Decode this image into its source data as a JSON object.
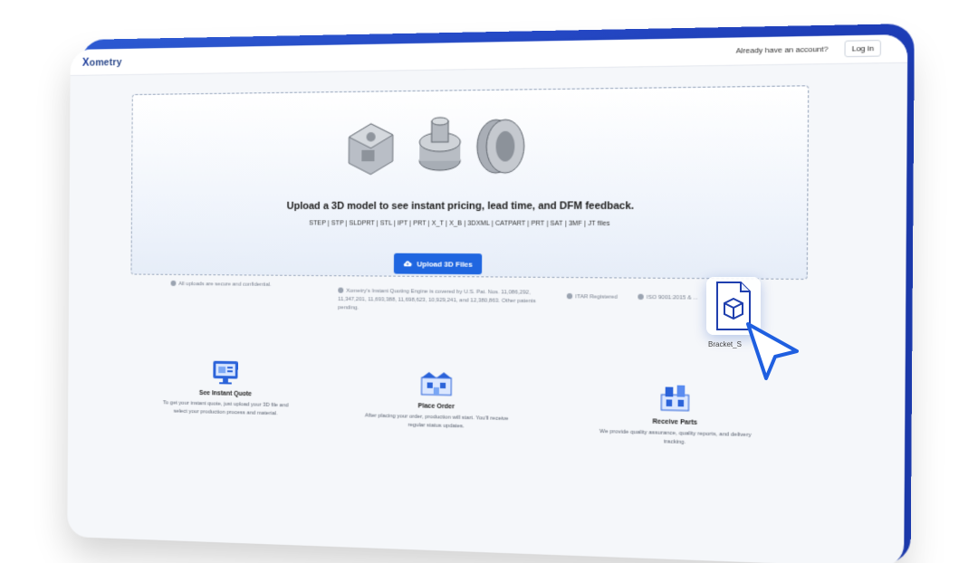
{
  "header": {
    "logo_mark": "X",
    "logo_text": "ometry",
    "account_prompt": "Already have an account?",
    "login_label": "Log in"
  },
  "upload": {
    "headline": "Upload a 3D model to see instant pricing, lead time, and DFM feedback.",
    "formats": "STEP | STP | SLDPRT | STL | IPT | PRT | X_T | X_B | 3DXML | CATPART | PRT | SAT | 3MF | JT files",
    "button_label": "Upload 3D Files",
    "button_icon": "cloud-upload-icon"
  },
  "notes": {
    "secure": "All uploads are secure and confidential.",
    "patents": "Xometry's Instant Quoting Engine is covered by U.S. Pat. Nos. 11,086,292, 11,347,201, 11,693,388, 11,698,623, 10,929,241, and 12,380,863. Other patents pending.",
    "itar": "ITAR Registered",
    "iso": "ISO 9001:2015 & ..."
  },
  "steps": [
    {
      "icon": "monitor-quote-icon",
      "title": "See Instant Quote",
      "desc": "To get your instant quote, just upload your 3D file and select your production process and material."
    },
    {
      "icon": "factory-order-icon",
      "title": "Place Order",
      "desc": "After placing your order, production will start. You'll receive regular status updates."
    },
    {
      "icon": "parts-delivery-icon",
      "title": "Receive Parts",
      "desc": "We provide quality assurance, quality reports, and delivery tracking."
    }
  ],
  "dragged_file": {
    "name": "Bracket_S",
    "icon": "cube-file-icon"
  },
  "colors": {
    "accent": "#1f66e0",
    "frame_edge": "#2448c7",
    "background": "#f5f7fa"
  }
}
